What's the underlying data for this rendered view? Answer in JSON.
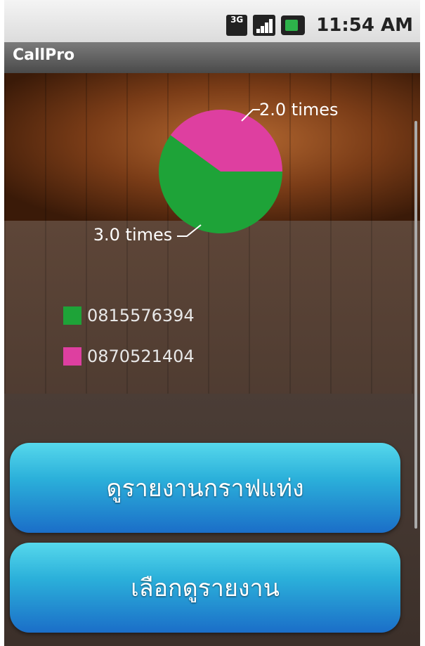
{
  "status_bar": {
    "network": "3G",
    "time": "11:54 AM",
    "icons": [
      "3g-icon",
      "signal-icon",
      "battery-icon"
    ]
  },
  "app": {
    "title": "CallPro"
  },
  "chart_data": {
    "type": "pie",
    "slices": [
      {
        "label": "0815576394",
        "value": 3.0,
        "data_label": "3.0 times",
        "color": "#1ea338"
      },
      {
        "label": "0870521404",
        "value": 2.0,
        "data_label": "2.0 times",
        "color": "#de3fa0"
      }
    ],
    "legend": [
      "0815576394",
      "0870521404"
    ],
    "legend_placement": "bottom-left"
  },
  "buttons": {
    "graph_report": "ดูรายงานกราฟแท่ง",
    "select_report": "เลือกดูรายงาน"
  },
  "colors": {
    "button_top": "#56d8ec",
    "button_bottom": "#1b6ec8",
    "slice_green": "#1ea338",
    "slice_pink": "#de3fa0"
  }
}
